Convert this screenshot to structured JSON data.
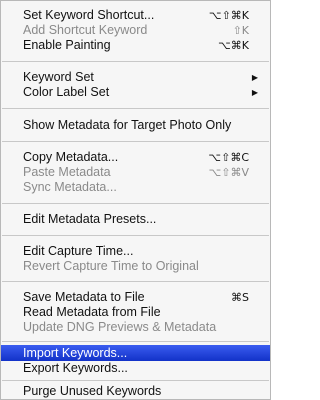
{
  "menu": {
    "items": [
      {
        "label": "Set Keyword Shortcut...",
        "shortcut": "⌥⇧⌘K",
        "enabled": true
      },
      {
        "label": "Add Shortcut Keyword",
        "shortcut": "⇧K",
        "enabled": false
      },
      {
        "label": "Enable Painting",
        "shortcut": "⌥⌘K",
        "enabled": true
      },
      {
        "label": "Keyword Set",
        "submenu": true,
        "enabled": true
      },
      {
        "label": "Color Label Set",
        "submenu": true,
        "enabled": true
      },
      {
        "label": "Show Metadata for Target Photo Only",
        "enabled": true
      },
      {
        "label": "Copy Metadata...",
        "shortcut": "⌥⇧⌘C",
        "enabled": true
      },
      {
        "label": "Paste Metadata",
        "shortcut": "⌥⇧⌘V",
        "enabled": false
      },
      {
        "label": "Sync Metadata...",
        "enabled": false
      },
      {
        "label": "Edit Metadata Presets...",
        "enabled": true
      },
      {
        "label": "Edit Capture Time...",
        "enabled": true
      },
      {
        "label": "Revert Capture Time to Original",
        "enabled": false
      },
      {
        "label": "Save Metadata to File",
        "shortcut": "⌘S",
        "enabled": true
      },
      {
        "label": "Read Metadata from File",
        "enabled": true
      },
      {
        "label": "Update DNG Previews & Metadata",
        "enabled": false
      },
      {
        "label": "Import Keywords...",
        "enabled": true,
        "highlighted": true
      },
      {
        "label": "Export Keywords...",
        "enabled": true
      },
      {
        "label": "Purge Unused Keywords",
        "enabled": true
      }
    ],
    "submenu_arrow_icon": "triangle-right-icon",
    "highlight_color": "#1f3fd8"
  }
}
